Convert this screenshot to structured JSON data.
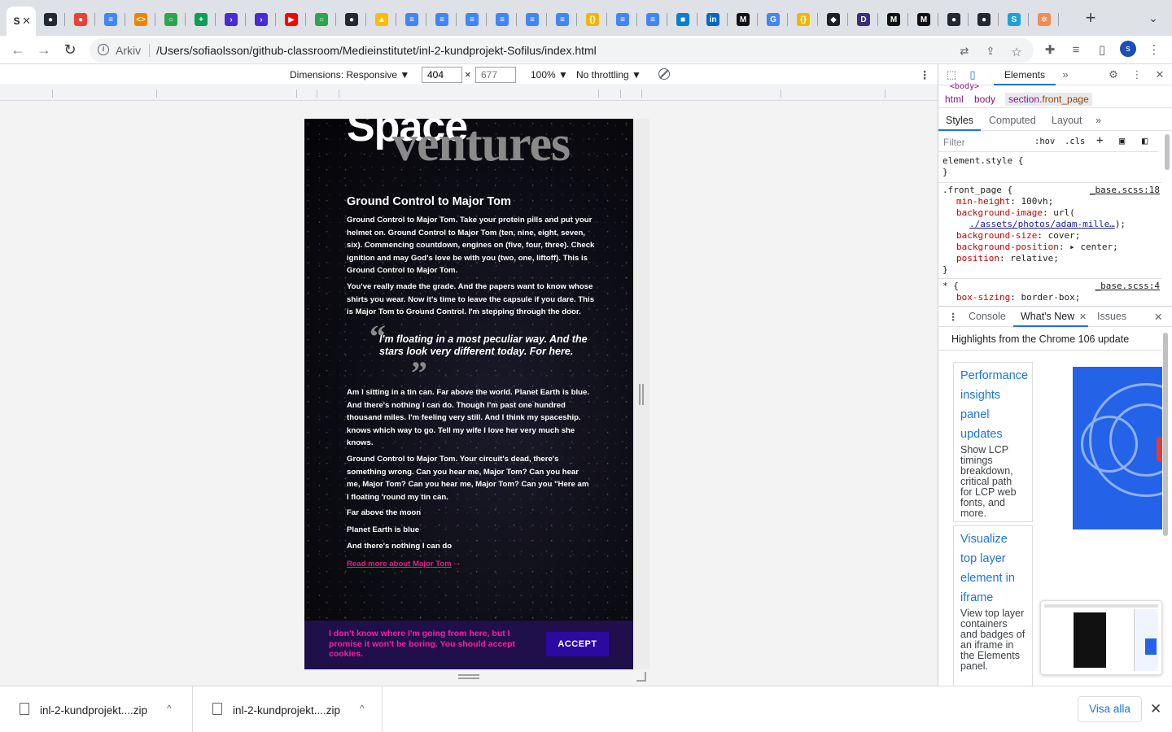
{
  "browser": {
    "active_tab": {
      "favicon_label": "S",
      "close_label": "✕"
    },
    "tabs": [
      {
        "icon": "github-icon",
        "label": "●",
        "color": "#24292f"
      },
      {
        "icon": "maps-pin-icon",
        "label": "●",
        "color": "#ea4335"
      },
      {
        "icon": "docs-icon",
        "label": "≡",
        "color": "#4285f4"
      },
      {
        "icon": "code-icon",
        "label": "<>",
        "color": "#ea8600"
      },
      {
        "icon": "github-green-icon",
        "label": "○",
        "color": "#2da44e"
      },
      {
        "icon": "sheets-icon",
        "label": "+",
        "color": "#0f9d58"
      },
      {
        "icon": "azure-pipelines-icon",
        "label": "›",
        "color": "#4b2bd6"
      },
      {
        "icon": "azure-pipelines-icon",
        "label": "›",
        "color": "#4b2bd6"
      },
      {
        "icon": "youtube-icon",
        "label": "▶",
        "color": "#ff0000"
      },
      {
        "icon": "github-green-icon",
        "label": "○",
        "color": "#2da44e"
      },
      {
        "icon": "github-icon",
        "label": "●",
        "color": "#24292f"
      },
      {
        "icon": "drive-icon",
        "label": "▲",
        "color": "#fbbc04"
      },
      {
        "icon": "docs-icon",
        "label": "≡",
        "color": "#4285f4"
      },
      {
        "icon": "docs-icon",
        "label": "≡",
        "color": "#4285f4"
      },
      {
        "icon": "docs-icon",
        "label": "≡",
        "color": "#4285f4"
      },
      {
        "icon": "docs-icon",
        "label": "≡",
        "color": "#4285f4"
      },
      {
        "icon": "docs-icon",
        "label": "≡",
        "color": "#4285f4"
      },
      {
        "icon": "docs-icon",
        "label": "≡",
        "color": "#4285f4"
      },
      {
        "icon": "json-icon",
        "label": "{}",
        "color": "#f4b400"
      },
      {
        "icon": "docs-icon",
        "label": "≡",
        "color": "#4285f4"
      },
      {
        "icon": "docs-icon",
        "label": "≡",
        "color": "#4285f4"
      },
      {
        "icon": "box-icon",
        "label": "■",
        "color": "#0a7fcf"
      },
      {
        "icon": "linkedin-icon",
        "label": "in",
        "color": "#0a66c2"
      },
      {
        "icon": "medium-icon",
        "label": "M",
        "color": "#111111"
      },
      {
        "icon": "google-icon",
        "label": "G",
        "color": "#4285f4"
      },
      {
        "icon": "json-icon",
        "label": "{}",
        "color": "#f4b400"
      },
      {
        "icon": "eraser-icon",
        "label": "◆",
        "color": "#202124"
      },
      {
        "icon": "devto-icon",
        "label": "D",
        "color": "#3d2e7c"
      },
      {
        "icon": "medium-icon",
        "label": "M",
        "color": "#111111"
      },
      {
        "icon": "medium-icon",
        "label": "M",
        "color": "#111111"
      },
      {
        "icon": "github-icon",
        "label": "●",
        "color": "#24292f"
      },
      {
        "icon": "github-icon",
        "label": "●",
        "color": "#24292f"
      },
      {
        "icon": "s-app-icon",
        "label": "S",
        "color": "#1fa0d8"
      },
      {
        "icon": "orange-gear-icon",
        "label": "✲",
        "color": "#f28b54"
      }
    ],
    "new_tab_label": "+",
    "tab_search_label": "⌄",
    "scheme_label": "Arkiv",
    "url": "/Users/sofiaolsson/github-classroom/Medieinstitutet/inl-2-kundprojekt-Sofilus/index.html",
    "profile_initial": "s"
  },
  "device_toolbar": {
    "dimensions": "Dimensions: Responsive ▼",
    "width": "404",
    "height_placeholder": "677",
    "times": "×",
    "zoom": "100% ▼",
    "throttling": "No throttling ▼"
  },
  "page": {
    "hero_line1": "Space",
    "hero_line2": "ventures",
    "heading": "Ground Control to Major Tom",
    "para1": "Ground Control to Major Tom. Take your protein pills and put your helmet on. Ground Control to Major Tom (ten, nine, eight, seven, six). Commencing countdown, engines on (five, four, three). Check ignition and may God's love be with you (two, one, liftoff). This is Ground Control to Major Tom.",
    "para2": "You've really made the grade. And the papers want to know whose shirts you wear. Now it's time to leave the capsule if you dare. This is Major Tom to Ground Control. I'm stepping through the door.",
    "quote_open": "“",
    "quote": "I'm floating in a most peculiar way. And the stars look very different today. For here.",
    "quote_close": "”",
    "para3": "Am I sitting in a tin can. Far above the world. Planet Earth is blue. And there's nothing I can do. Though I'm past one hundred thousand miles. I'm feeling very still. And I think my spaceship. knows which way to go. Tell my wife I love her very much she knows.",
    "para4": "Ground Control to Major Tom. Your circuit's dead, there's something wrong. Can you hear me, Major Tom? Can you hear me, Major Tom? Can you hear me, Major Tom? Can you \"Here am I floating 'round my tin can.",
    "line1": "Far above the moon",
    "line2": "Planet Earth is blue",
    "line3": "And there's nothing I can do",
    "link": "Read more about Major Tom",
    "link_arrow": "→",
    "cookie_text": "I don't know where I'm going from here, but I promise it won't be boring. You should accept cookies.",
    "accept": "ACCEPT"
  },
  "devtools": {
    "tab_elements": "Elements",
    "more": "»",
    "body_tag": "<body>",
    "breadcrumb": [
      "html",
      "body"
    ],
    "breadcrumb_sel_tag": "section",
    "breadcrumb_sel_class": ".front_page",
    "subtabs": [
      "Styles",
      "Computed",
      "Layout",
      "»"
    ],
    "filter_placeholder": "Filter",
    "hov": ":hov",
    "cls": ".cls",
    "rules": {
      "element_style": "element.style {",
      "close": "}",
      "front_page_selector": ".front_page {",
      "front_page_src": "_base.scss:18",
      "p1_name": "min-height",
      "p1_val": ": 100vh;",
      "p2_name": "background-image",
      "p2_val": ": url(",
      "p2_url": "./assets/photos/adam-mille…",
      "p2_end": ");",
      "p3_name": "background-size",
      "p3_val": ": cover;",
      "p4_name": "background-position",
      "p4_val": ": ▸ center;",
      "p5_name": "position",
      "p5_val": ": relative;",
      "star_selector": "* {",
      "star_src": "_base.scss:4",
      "p6_name": "box-sizing",
      "p6_val": ": border-box;"
    },
    "drawer_tabs": [
      "Console",
      "What's New",
      "Issues"
    ],
    "drawer_close": "✕",
    "highlights": "Highlights from the Chrome 106 update",
    "card1_title": "Performance insights panel updates",
    "card1_desc": "Show LCP timings breakdown, critical path for LCP web fonts, and more.",
    "card2_title": "Visualize top layer element in iframe",
    "card2_desc": "View top layer containers and badges of an iframe in the Elements panel."
  },
  "downloads": {
    "items": [
      {
        "name": "inl-2-kundprojekt....zip",
        "caret": "^"
      },
      {
        "name": "inl-2-kundprojekt....zip",
        "caret": "^"
      }
    ],
    "show_all": "Visa alla",
    "close": "✕"
  }
}
